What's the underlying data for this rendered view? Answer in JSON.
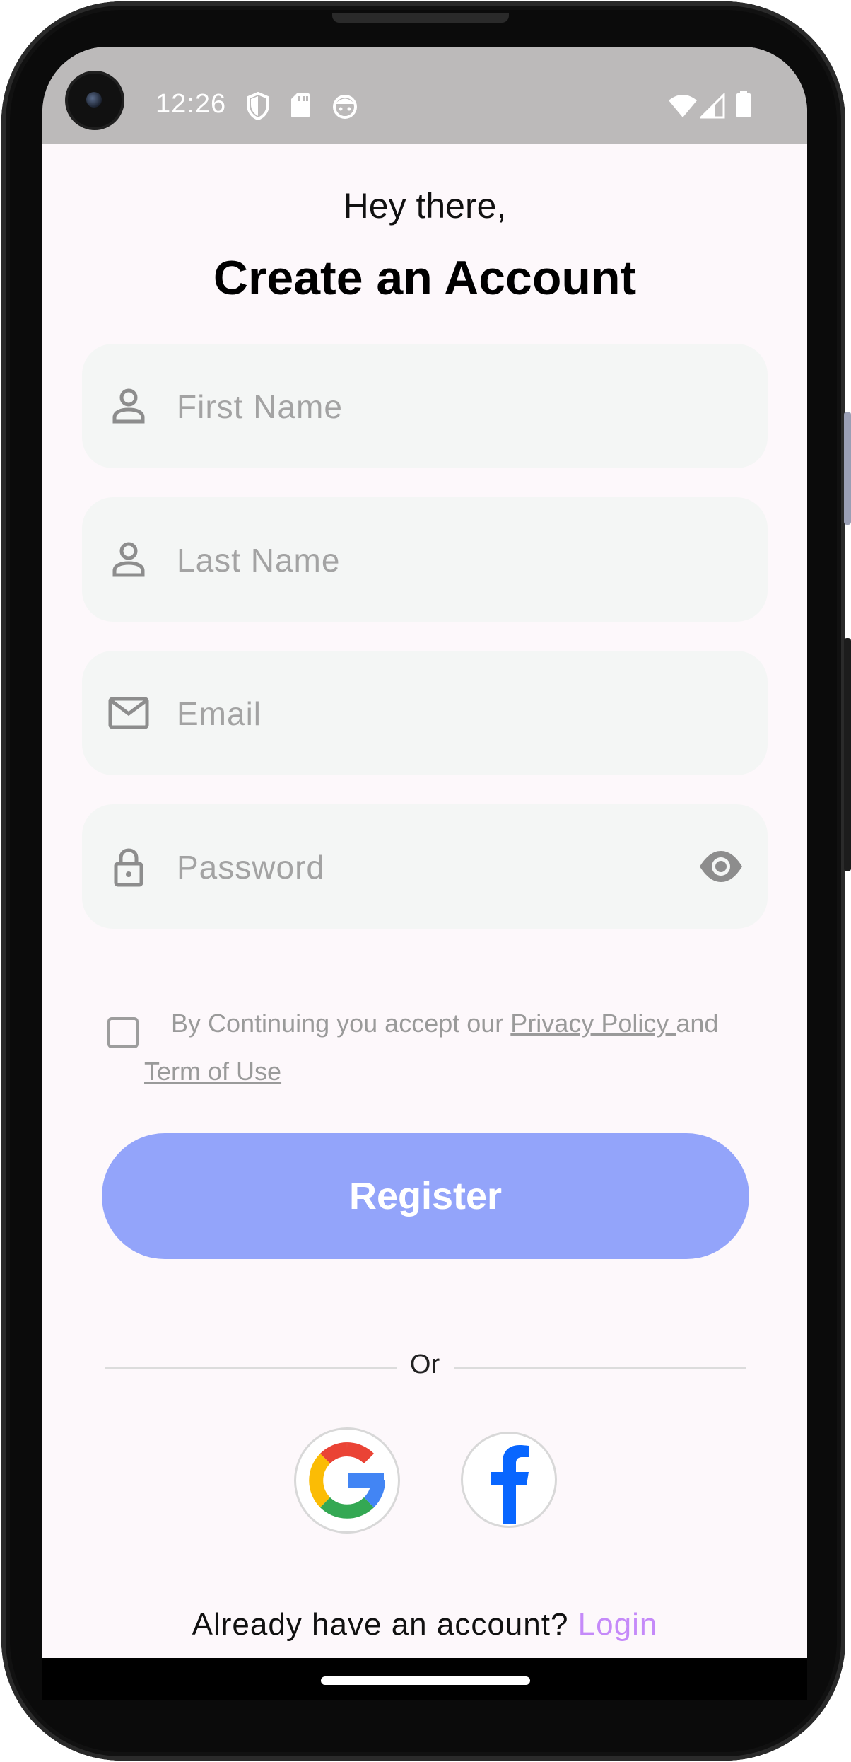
{
  "status_bar": {
    "time": "12:26",
    "icons": [
      "shield-icon",
      "sd-card-icon",
      "android-face-icon",
      "wifi-icon",
      "cellular-signal-icon",
      "battery-icon"
    ]
  },
  "header": {
    "greeting": "Hey there,",
    "title": "Create an Account"
  },
  "form": {
    "first_name": {
      "placeholder": "First Name",
      "value": "",
      "icon": "person-icon"
    },
    "last_name": {
      "placeholder": "Last Name",
      "value": "",
      "icon": "person-icon"
    },
    "email": {
      "placeholder": "Email",
      "value": "",
      "icon": "mail-icon"
    },
    "password": {
      "placeholder": "Password",
      "value": "",
      "icon": "lock-icon",
      "toggle_icon": "eye-icon"
    }
  },
  "terms": {
    "checked": false,
    "prefix": "By Continuing you accept our ",
    "privacy_link": "Privacy Policy ",
    "connector": "and",
    "terms_link": "Term of Use"
  },
  "actions": {
    "register_label": "Register",
    "divider_label": "Or",
    "social": [
      "google-logo-icon",
      "facebook-logo-icon"
    ]
  },
  "footer": {
    "prompt": "Already have an account? ",
    "login_label": "Login"
  },
  "colors": {
    "accent": "#93a4fa",
    "login_link": "#c58af9",
    "field_bg": "#f4f6f5",
    "screen_bg": "#fdf8fb"
  }
}
